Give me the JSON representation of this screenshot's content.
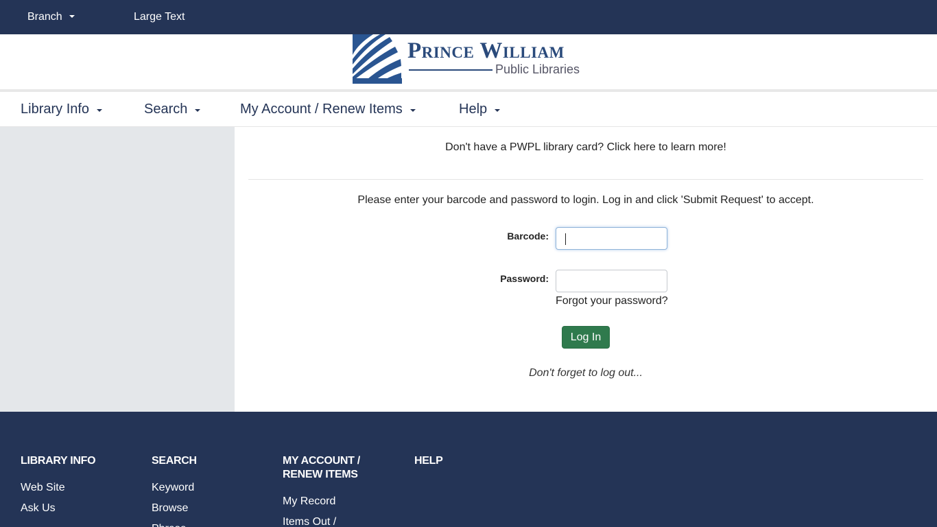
{
  "topbar": {
    "branch_label": "Branch",
    "large_text_label": "Large Text"
  },
  "logo": {
    "line1": "Prince William",
    "line2": "Public Libraries"
  },
  "nav": {
    "items": [
      {
        "label": "Library Info"
      },
      {
        "label": "Search"
      },
      {
        "label": "My Account / Renew Items"
      },
      {
        "label": "Help"
      }
    ]
  },
  "main": {
    "card_note_prefix": "Don't have a PWPL library card? ",
    "card_note_link": "Click here",
    "card_note_suffix": " to learn more!",
    "instructions": "Please enter your barcode and password to login. Log in and click 'Submit Request' to accept.",
    "barcode_label": "Barcode:",
    "barcode_value": "",
    "password_label": "Password:",
    "password_value": "",
    "forgot_label": "Forgot your password?",
    "login_button": "Log In",
    "logout_note": "Don't forget to log out..."
  },
  "footer": {
    "columns": [
      {
        "heading": "Library Info",
        "links": [
          "Web Site",
          "Ask Us"
        ]
      },
      {
        "heading": "Search",
        "links": [
          "Keyword",
          "Browse",
          "Phrase"
        ]
      },
      {
        "heading": "My Account / Renew Items",
        "links": [
          "My Record",
          "Items Out /"
        ]
      },
      {
        "heading": "Help",
        "links": []
      }
    ]
  },
  "colors": {
    "navy": "#243456",
    "brand_blue": "#2a4a7b",
    "login_green": "#2f7a4d",
    "sidebar_gray": "#e4e7ea"
  }
}
